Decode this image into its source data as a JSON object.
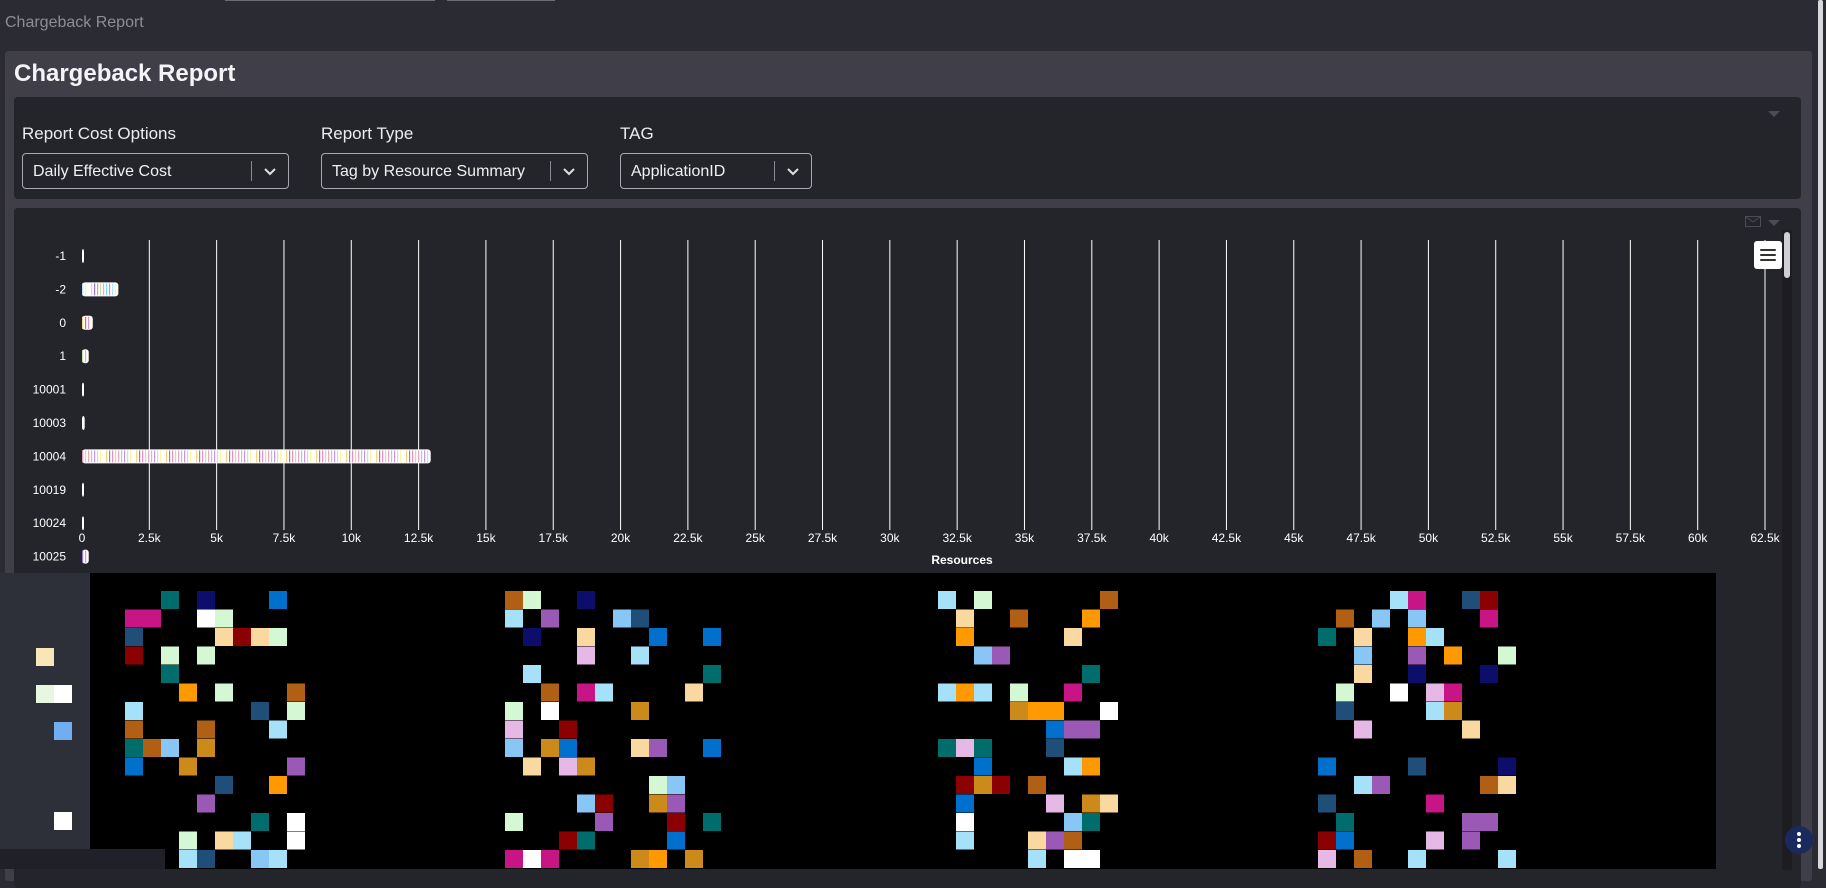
{
  "breadcrumb": "Chargeback Report",
  "page_title": "Chargeback Report",
  "options": {
    "cost_label": "Report Cost Options",
    "cost_value": "Daily Effective Cost",
    "type_label": "Report Type",
    "type_value": "Tag by Resource Summary",
    "tag_label": "TAG",
    "tag_value": "ApplicationID"
  },
  "icons": [
    "chevron-down-icon",
    "menu-icon",
    "mail-icon",
    "more-vertical-icon",
    "collapse-icon"
  ],
  "colors": {
    "background": "#2b2b33",
    "panel": "#3f3e49",
    "card": "#24252b",
    "gridline": "#ffffff"
  },
  "chart_data": {
    "type": "bar",
    "orientation": "horizontal",
    "stacked": true,
    "categories": [
      "-1",
      "-2",
      "0",
      "1",
      "10001",
      "10003",
      "10004",
      "10019",
      "10024",
      "10025"
    ],
    "values": [
      60,
      1350,
      400,
      250,
      60,
      100,
      12950,
      40,
      60,
      250
    ],
    "xlabel": "Resources",
    "xlim": [
      0,
      62500
    ],
    "xticks": [
      "0",
      "2.5k",
      "5k",
      "7.5k",
      "10k",
      "12.5k",
      "15k",
      "17.5k",
      "20k",
      "22.5k",
      "25k",
      "27.5k",
      "30k",
      "32.5k",
      "35k",
      "37.5k",
      "40k",
      "42.5k",
      "45k",
      "47.5k",
      "50k",
      "52.5k",
      "55k",
      "57.5k",
      "60k",
      "62.5k"
    ],
    "grid": true,
    "segment_colors": [
      "#f4a3c3",
      "#b3e5fc",
      "#ffd180",
      "#c5e1a5",
      "#ce93d8",
      "#ffffff",
      "#f48fb1",
      "#80deea",
      "#fff59d",
      "#9575cd"
    ]
  }
}
